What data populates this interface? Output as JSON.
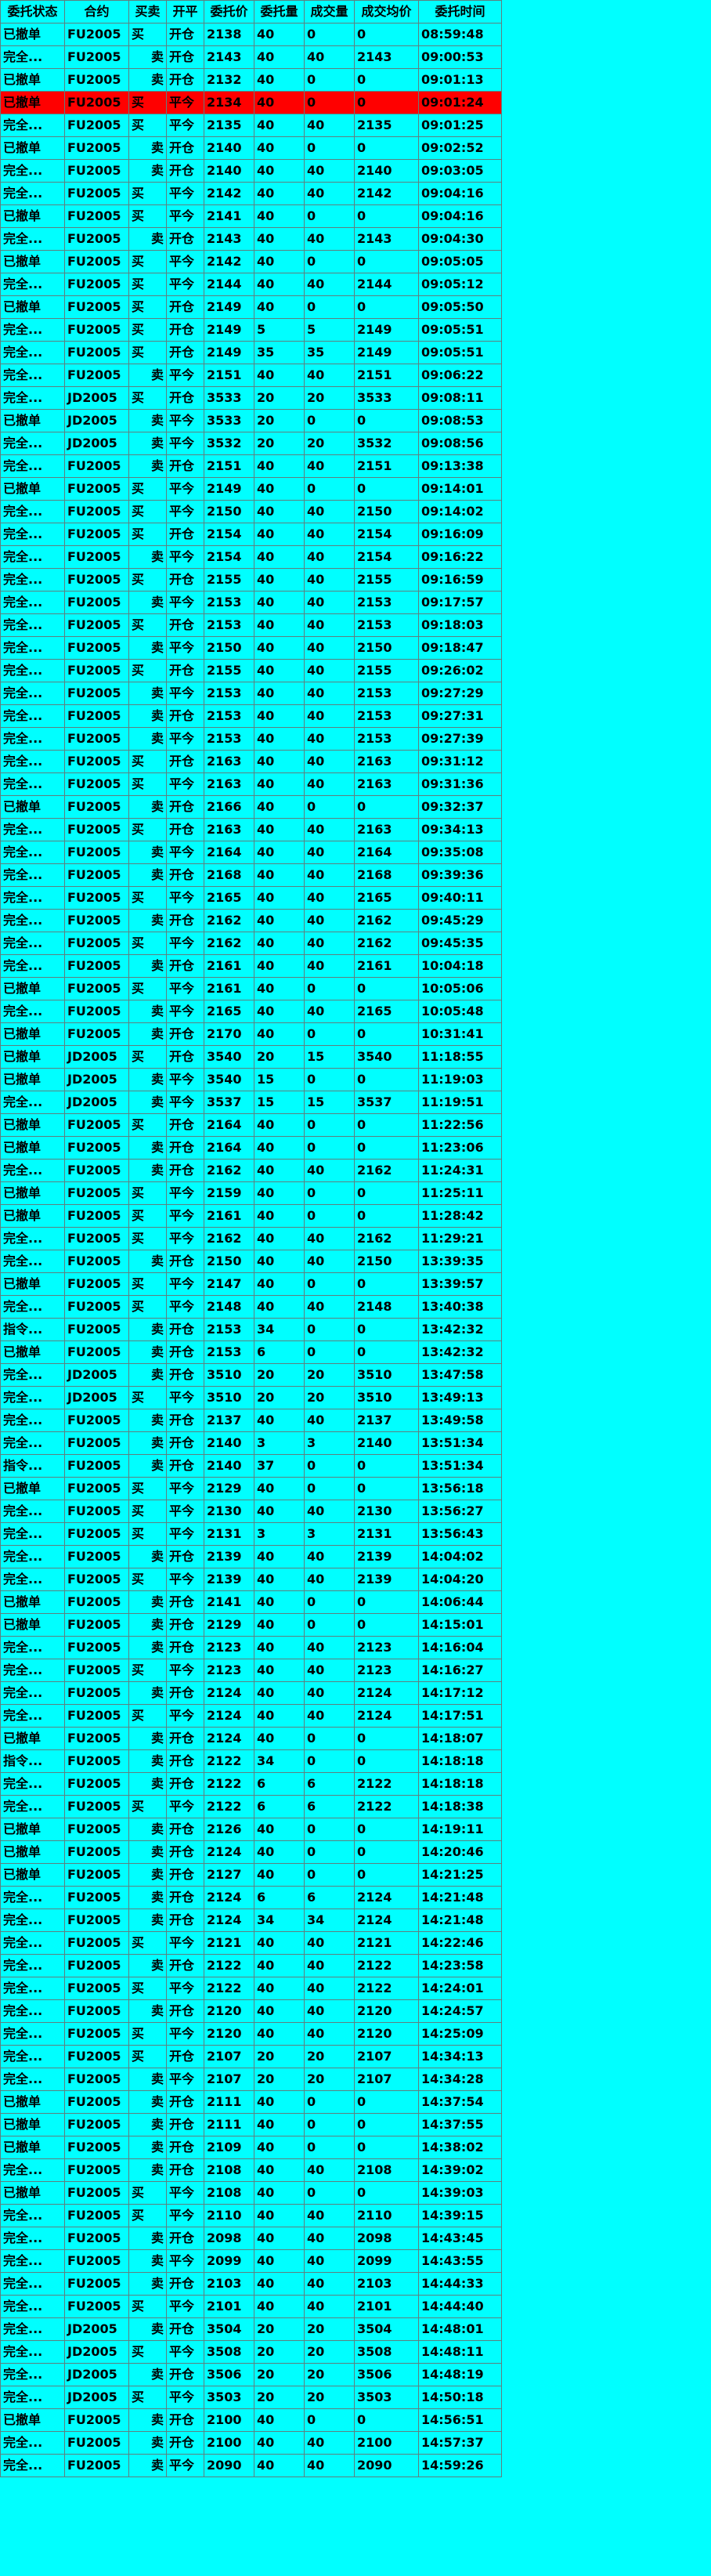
{
  "headers": [
    "委托状态",
    "合约",
    "买卖",
    "开平",
    "委托价",
    "委托量",
    "成交量",
    "成交均价",
    "委托时间"
  ],
  "colors": {
    "background": "#00ffff",
    "buy": "#ff0000",
    "sell": "#008000",
    "status": "#008000",
    "highlight_row": "#ff0000",
    "order_error": "#ff0000"
  },
  "side_labels": {
    "b": "买",
    "s": "卖"
  },
  "oc_labels": {
    "o": "开仓",
    "c": "平今"
  },
  "rows": [
    [
      "已撤单",
      "FU2005",
      "b",
      "o",
      "2138",
      "40",
      "0",
      "0",
      "08:59:48"
    ],
    [
      "完全...",
      "FU2005",
      "s",
      "o",
      "2143",
      "40",
      "40",
      "2143",
      "09:00:53"
    ],
    [
      "已撤单",
      "FU2005",
      "s",
      "o",
      "2132",
      "40",
      "0",
      "0",
      "09:01:13"
    ],
    [
      "已撤单",
      "FU2005",
      "b",
      "c",
      "2134",
      "40",
      "0",
      "0",
      "09:01:24"
    ],
    [
      "完全...",
      "FU2005",
      "b",
      "c",
      "2135",
      "40",
      "40",
      "2135",
      "09:01:25"
    ],
    [
      "已撤单",
      "FU2005",
      "s",
      "o",
      "2140",
      "40",
      "0",
      "0",
      "09:02:52"
    ],
    [
      "完全...",
      "FU2005",
      "s",
      "o",
      "2140",
      "40",
      "40",
      "2140",
      "09:03:05"
    ],
    [
      "完全...",
      "FU2005",
      "b",
      "c",
      "2142",
      "40",
      "40",
      "2142",
      "09:04:16"
    ],
    [
      "已撤单",
      "FU2005",
      "b",
      "c",
      "2141",
      "40",
      "0",
      "0",
      "09:04:16"
    ],
    [
      "完全...",
      "FU2005",
      "s",
      "o",
      "2143",
      "40",
      "40",
      "2143",
      "09:04:30"
    ],
    [
      "已撤单",
      "FU2005",
      "b",
      "c",
      "2142",
      "40",
      "0",
      "0",
      "09:05:05"
    ],
    [
      "完全...",
      "FU2005",
      "b",
      "c",
      "2144",
      "40",
      "40",
      "2144",
      "09:05:12"
    ],
    [
      "已撤单",
      "FU2005",
      "b",
      "o",
      "2149",
      "40",
      "0",
      "0",
      "09:05:50"
    ],
    [
      "完全...",
      "FU2005",
      "b",
      "o",
      "2149",
      "5",
      "5",
      "2149",
      "09:05:51"
    ],
    [
      "完全...",
      "FU2005",
      "b",
      "o",
      "2149",
      "35",
      "35",
      "2149",
      "09:05:51"
    ],
    [
      "完全...",
      "FU2005",
      "s",
      "c",
      "2151",
      "40",
      "40",
      "2151",
      "09:06:22"
    ],
    [
      "完全...",
      "JD2005",
      "b",
      "o",
      "3533",
      "20",
      "20",
      "3533",
      "09:08:11"
    ],
    [
      "已撤单",
      "JD2005",
      "s",
      "c",
      "3533",
      "20",
      "0",
      "0",
      "09:08:53"
    ],
    [
      "完全...",
      "JD2005",
      "s",
      "c",
      "3532",
      "20",
      "20",
      "3532",
      "09:08:56"
    ],
    [
      "完全...",
      "FU2005",
      "s",
      "o",
      "2151",
      "40",
      "40",
      "2151",
      "09:13:38"
    ],
    [
      "已撤单",
      "FU2005",
      "b",
      "c",
      "2149",
      "40",
      "0",
      "0",
      "09:14:01"
    ],
    [
      "完全...",
      "FU2005",
      "b",
      "c",
      "2150",
      "40",
      "40",
      "2150",
      "09:14:02"
    ],
    [
      "完全...",
      "FU2005",
      "b",
      "o",
      "2154",
      "40",
      "40",
      "2154",
      "09:16:09"
    ],
    [
      "完全...",
      "FU2005",
      "s",
      "c",
      "2154",
      "40",
      "40",
      "2154",
      "09:16:22"
    ],
    [
      "完全...",
      "FU2005",
      "b",
      "o",
      "2155",
      "40",
      "40",
      "2155",
      "09:16:59"
    ],
    [
      "完全...",
      "FU2005",
      "s",
      "c",
      "2153",
      "40",
      "40",
      "2153",
      "09:17:57"
    ],
    [
      "完全...",
      "FU2005",
      "b",
      "o",
      "2153",
      "40",
      "40",
      "2153",
      "09:18:03"
    ],
    [
      "完全...",
      "FU2005",
      "s",
      "c",
      "2150",
      "40",
      "40",
      "2150",
      "09:18:47"
    ],
    [
      "完全...",
      "FU2005",
      "b",
      "o",
      "2155",
      "40",
      "40",
      "2155",
      "09:26:02"
    ],
    [
      "完全...",
      "FU2005",
      "s",
      "c",
      "2153",
      "40",
      "40",
      "2153",
      "09:27:29"
    ],
    [
      "完全...",
      "FU2005",
      "s",
      "o",
      "2153",
      "40",
      "40",
      "2153",
      "09:27:31"
    ],
    [
      "完全...",
      "FU2005",
      "s",
      "c",
      "2153",
      "40",
      "40",
      "2153",
      "09:27:39"
    ],
    [
      "完全...",
      "FU2005",
      "b",
      "o",
      "2163",
      "40",
      "40",
      "2163",
      "09:31:12"
    ],
    [
      "完全...",
      "FU2005",
      "b",
      "c",
      "2163",
      "40",
      "40",
      "2163",
      "09:31:36"
    ],
    [
      "已撤单",
      "FU2005",
      "s",
      "o",
      "2166",
      "40",
      "0",
      "0",
      "09:32:37"
    ],
    [
      "完全...",
      "FU2005",
      "b",
      "o",
      "2163",
      "40",
      "40",
      "2163",
      "09:34:13"
    ],
    [
      "完全...",
      "FU2005",
      "s",
      "c",
      "2164",
      "40",
      "40",
      "2164",
      "09:35:08"
    ],
    [
      "完全...",
      "FU2005",
      "s",
      "o",
      "2168",
      "40",
      "40",
      "2168",
      "09:39:36"
    ],
    [
      "完全...",
      "FU2005",
      "b",
      "c",
      "2165",
      "40",
      "40",
      "2165",
      "09:40:11"
    ],
    [
      "完全...",
      "FU2005",
      "s",
      "o",
      "2162",
      "40",
      "40",
      "2162",
      "09:45:29"
    ],
    [
      "完全...",
      "FU2005",
      "b",
      "c",
      "2162",
      "40",
      "40",
      "2162",
      "09:45:35"
    ],
    [
      "完全...",
      "FU2005",
      "s",
      "o",
      "2161",
      "40",
      "40",
      "2161",
      "10:04:18"
    ],
    [
      "已撤单",
      "FU2005",
      "b",
      "c",
      "2161",
      "40",
      "0",
      "0",
      "10:05:06"
    ],
    [
      "完全...",
      "FU2005",
      "s",
      "c",
      "2165",
      "40",
      "40",
      "2165",
      "10:05:48"
    ],
    [
      "已撤单",
      "FU2005",
      "s",
      "o",
      "2170",
      "40",
      "0",
      "0",
      "10:31:41"
    ],
    [
      "已撤单",
      "JD2005",
      "b",
      "o",
      "3540",
      "20",
      "15",
      "3540",
      "11:18:55"
    ],
    [
      "已撤单",
      "JD2005",
      "s",
      "c",
      "3540",
      "15",
      "0",
      "0",
      "11:19:03"
    ],
    [
      "完全...",
      "JD2005",
      "s",
      "c",
      "3537",
      "15",
      "15",
      "3537",
      "11:19:51"
    ],
    [
      "已撤单",
      "FU2005",
      "b",
      "o",
      "2164",
      "40",
      "0",
      "0",
      "11:22:56"
    ],
    [
      "已撤单",
      "FU2005",
      "s",
      "o",
      "2164",
      "40",
      "0",
      "0",
      "11:23:06"
    ],
    [
      "完全...",
      "FU2005",
      "s",
      "o",
      "2162",
      "40",
      "40",
      "2162",
      "11:24:31"
    ],
    [
      "已撤单",
      "FU2005",
      "b",
      "c",
      "2159",
      "40",
      "0",
      "0",
      "11:25:11"
    ],
    [
      "已撤单",
      "FU2005",
      "b",
      "c",
      "2161",
      "40",
      "0",
      "0",
      "11:28:42"
    ],
    [
      "完全...",
      "FU2005",
      "b",
      "c",
      "2162",
      "40",
      "40",
      "2162",
      "11:29:21"
    ],
    [
      "完全...",
      "FU2005",
      "s",
      "o",
      "2150",
      "40",
      "40",
      "2150",
      "13:39:35"
    ],
    [
      "已撤单",
      "FU2005",
      "b",
      "c",
      "2147",
      "40",
      "0",
      "0",
      "13:39:57"
    ],
    [
      "完全...",
      "FU2005",
      "b",
      "c",
      "2148",
      "40",
      "40",
      "2148",
      "13:40:38"
    ],
    [
      "指令...",
      "FU2005",
      "s",
      "o",
      "2153",
      "34",
      "0",
      "0",
      "13:42:32"
    ],
    [
      "已撤单",
      "FU2005",
      "s",
      "o",
      "2153",
      "6",
      "0",
      "0",
      "13:42:32"
    ],
    [
      "完全...",
      "JD2005",
      "s",
      "o",
      "3510",
      "20",
      "20",
      "3510",
      "13:47:58"
    ],
    [
      "完全...",
      "JD2005",
      "b",
      "c",
      "3510",
      "20",
      "20",
      "3510",
      "13:49:13"
    ],
    [
      "完全...",
      "FU2005",
      "s",
      "o",
      "2137",
      "40",
      "40",
      "2137",
      "13:49:58"
    ],
    [
      "完全...",
      "FU2005",
      "s",
      "o",
      "2140",
      "3",
      "3",
      "2140",
      "13:51:34"
    ],
    [
      "指令...",
      "FU2005",
      "s",
      "o",
      "2140",
      "37",
      "0",
      "0",
      "13:51:34"
    ],
    [
      "已撤单",
      "FU2005",
      "b",
      "c",
      "2129",
      "40",
      "0",
      "0",
      "13:56:18"
    ],
    [
      "完全...",
      "FU2005",
      "b",
      "c",
      "2130",
      "40",
      "40",
      "2130",
      "13:56:27"
    ],
    [
      "完全...",
      "FU2005",
      "b",
      "c",
      "2131",
      "3",
      "3",
      "2131",
      "13:56:43"
    ],
    [
      "完全...",
      "FU2005",
      "s",
      "o",
      "2139",
      "40",
      "40",
      "2139",
      "14:04:02"
    ],
    [
      "完全...",
      "FU2005",
      "b",
      "c",
      "2139",
      "40",
      "40",
      "2139",
      "14:04:20"
    ],
    [
      "已撤单",
      "FU2005",
      "s",
      "o",
      "2141",
      "40",
      "0",
      "0",
      "14:06:44"
    ],
    [
      "已撤单",
      "FU2005",
      "s",
      "o",
      "2129",
      "40",
      "0",
      "0",
      "14:15:01"
    ],
    [
      "完全...",
      "FU2005",
      "s",
      "o",
      "2123",
      "40",
      "40",
      "2123",
      "14:16:04"
    ],
    [
      "完全...",
      "FU2005",
      "b",
      "c",
      "2123",
      "40",
      "40",
      "2123",
      "14:16:27"
    ],
    [
      "完全...",
      "FU2005",
      "s",
      "o",
      "2124",
      "40",
      "40",
      "2124",
      "14:17:12"
    ],
    [
      "完全...",
      "FU2005",
      "b",
      "c",
      "2124",
      "40",
      "40",
      "2124",
      "14:17:51"
    ],
    [
      "已撤单",
      "FU2005",
      "s",
      "o",
      "2124",
      "40",
      "0",
      "0",
      "14:18:07"
    ],
    [
      "指令...",
      "FU2005",
      "s",
      "o",
      "2122",
      "34",
      "0",
      "0",
      "14:18:18"
    ],
    [
      "完全...",
      "FU2005",
      "s",
      "o",
      "2122",
      "6",
      "6",
      "2122",
      "14:18:18"
    ],
    [
      "完全...",
      "FU2005",
      "b",
      "c",
      "2122",
      "6",
      "6",
      "2122",
      "14:18:38"
    ],
    [
      "已撤单",
      "FU2005",
      "s",
      "o",
      "2126",
      "40",
      "0",
      "0",
      "14:19:11"
    ],
    [
      "已撤单",
      "FU2005",
      "s",
      "o",
      "2124",
      "40",
      "0",
      "0",
      "14:20:46"
    ],
    [
      "已撤单",
      "FU2005",
      "s",
      "o",
      "2127",
      "40",
      "0",
      "0",
      "14:21:25"
    ],
    [
      "完全...",
      "FU2005",
      "s",
      "o",
      "2124",
      "6",
      "6",
      "2124",
      "14:21:48"
    ],
    [
      "完全...",
      "FU2005",
      "s",
      "o",
      "2124",
      "34",
      "34",
      "2124",
      "14:21:48"
    ],
    [
      "完全...",
      "FU2005",
      "b",
      "c",
      "2121",
      "40",
      "40",
      "2121",
      "14:22:46"
    ],
    [
      "完全...",
      "FU2005",
      "s",
      "o",
      "2122",
      "40",
      "40",
      "2122",
      "14:23:58"
    ],
    [
      "完全...",
      "FU2005",
      "b",
      "c",
      "2122",
      "40",
      "40",
      "2122",
      "14:24:01"
    ],
    [
      "完全...",
      "FU2005",
      "s",
      "o",
      "2120",
      "40",
      "40",
      "2120",
      "14:24:57"
    ],
    [
      "完全...",
      "FU2005",
      "b",
      "c",
      "2120",
      "40",
      "40",
      "2120",
      "14:25:09"
    ],
    [
      "完全...",
      "FU2005",
      "b",
      "o",
      "2107",
      "20",
      "20",
      "2107",
      "14:34:13"
    ],
    [
      "完全...",
      "FU2005",
      "s",
      "c",
      "2107",
      "20",
      "20",
      "2107",
      "14:34:28"
    ],
    [
      "已撤单",
      "FU2005",
      "s",
      "o",
      "2111",
      "40",
      "0",
      "0",
      "14:37:54"
    ],
    [
      "已撤单",
      "FU2005",
      "s",
      "o",
      "2111",
      "40",
      "0",
      "0",
      "14:37:55"
    ],
    [
      "已撤单",
      "FU2005",
      "s",
      "o",
      "2109",
      "40",
      "0",
      "0",
      "14:38:02"
    ],
    [
      "完全...",
      "FU2005",
      "s",
      "o",
      "2108",
      "40",
      "40",
      "2108",
      "14:39:02"
    ],
    [
      "已撤单",
      "FU2005",
      "b",
      "c",
      "2108",
      "40",
      "0",
      "0",
      "14:39:03"
    ],
    [
      "完全...",
      "FU2005",
      "b",
      "c",
      "2110",
      "40",
      "40",
      "2110",
      "14:39:15"
    ],
    [
      "完全...",
      "FU2005",
      "s",
      "o",
      "2098",
      "40",
      "40",
      "2098",
      "14:43:45"
    ],
    [
      "完全...",
      "FU2005",
      "s",
      "c",
      "2099",
      "40",
      "40",
      "2099",
      "14:43:55"
    ],
    [
      "完全...",
      "FU2005",
      "s",
      "o",
      "2103",
      "40",
      "40",
      "2103",
      "14:44:33"
    ],
    [
      "完全...",
      "FU2005",
      "b",
      "c",
      "2101",
      "40",
      "40",
      "2101",
      "14:44:40"
    ],
    [
      "完全...",
      "JD2005",
      "s",
      "o",
      "3504",
      "20",
      "20",
      "3504",
      "14:48:01"
    ],
    [
      "完全...",
      "JD2005",
      "b",
      "c",
      "3508",
      "20",
      "20",
      "3508",
      "14:48:11"
    ],
    [
      "完全...",
      "JD2005",
      "s",
      "o",
      "3506",
      "20",
      "20",
      "3506",
      "14:48:19"
    ],
    [
      "完全...",
      "JD2005",
      "b",
      "c",
      "3503",
      "20",
      "20",
      "3503",
      "14:50:18"
    ],
    [
      "已撤单",
      "FU2005",
      "s",
      "o",
      "2100",
      "40",
      "0",
      "0",
      "14:56:51"
    ],
    [
      "完全...",
      "FU2005",
      "s",
      "o",
      "2100",
      "40",
      "40",
      "2100",
      "14:57:37"
    ],
    [
      "完全...",
      "FU2005",
      "s",
      "c",
      "2090",
      "40",
      "40",
      "2090",
      "14:59:26"
    ]
  ],
  "highlighted_row_index": 3
}
